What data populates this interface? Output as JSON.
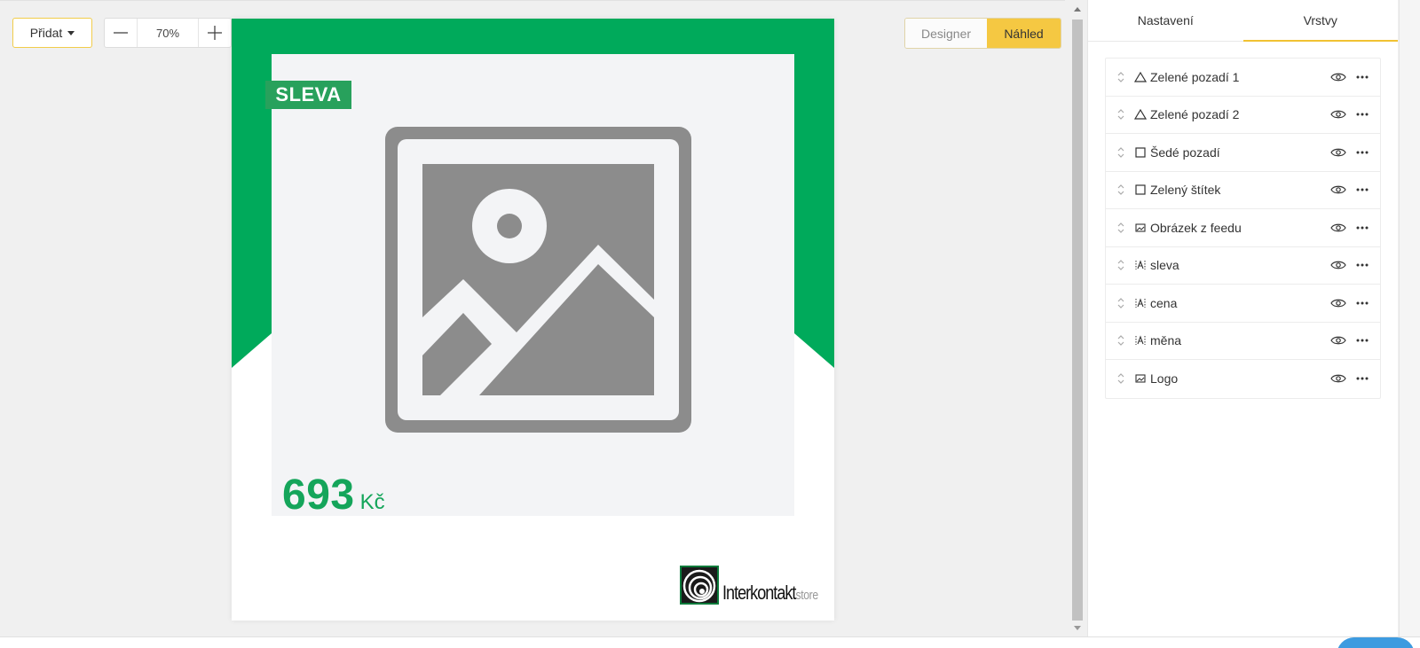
{
  "toolbar": {
    "add_label": "Přidat",
    "zoom_value": "70%",
    "mode_designer": "Designer",
    "mode_preview": "Náhled"
  },
  "canvas": {
    "badge_text": "SLEVA",
    "price": "693",
    "currency": "Kč",
    "logo_brand": "Interkontakt",
    "logo_suffix": "store"
  },
  "panel": {
    "tabs": [
      {
        "label": "Nastavení",
        "active": false
      },
      {
        "label": "Vrstvy",
        "active": true
      }
    ],
    "layers": [
      {
        "icon": "triangle-icon",
        "label": "Zelené pozadí 1"
      },
      {
        "icon": "triangle-icon",
        "label": "Zelené pozadí 2"
      },
      {
        "icon": "square-icon",
        "label": "Šedé pozadí"
      },
      {
        "icon": "square-icon",
        "label": "Zelený štítek"
      },
      {
        "icon": "image-icon",
        "label": "Obrázek z feedu"
      },
      {
        "icon": "text-icon",
        "label": "sleva"
      },
      {
        "icon": "text-icon",
        "label": "cena"
      },
      {
        "icon": "text-icon",
        "label": "měna"
      },
      {
        "icon": "image-icon",
        "label": "Logo"
      }
    ]
  },
  "colors": {
    "green": "#00aa5b",
    "accent_yellow": "#f5c842",
    "price_green": "#14a55a"
  }
}
